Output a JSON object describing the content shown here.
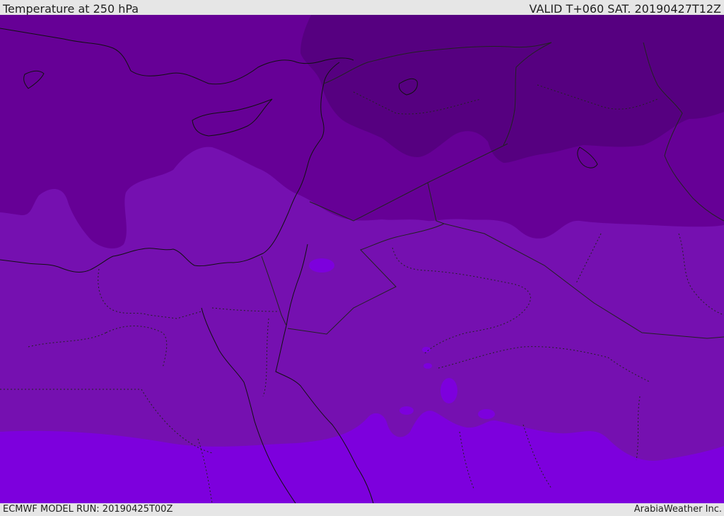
{
  "header": {
    "title": "Temperature at 250 hPa",
    "valid_time": "VALID T+060 SAT. 20190427T12Z"
  },
  "footer": {
    "model_run": "ECMWF MODEL RUN: 20190425T00Z",
    "brand": "ArabiaWeather Inc."
  },
  "colors": {
    "band_coldest": "#560080",
    "band_cold": "#660096",
    "band_mid": "#7510b0",
    "band_warm": "#7d00dd",
    "coast_line": "#111111",
    "border_line": "#222222"
  }
}
